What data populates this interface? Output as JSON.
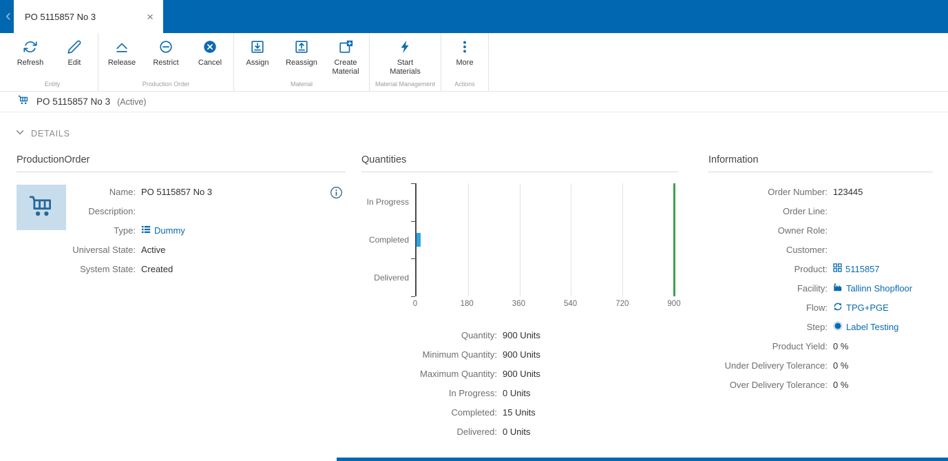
{
  "colors": {
    "topbar": "#0067b0",
    "icon_blue": "#0c6bb0",
    "link": "#0a6ab0",
    "bar_blue": "#2aa5e5",
    "limit_green": "#3ba449",
    "tile_bg": "#c8ddec"
  },
  "topbar": {
    "back_glyph": "‹",
    "tab_title": "PO 5115857 No 3",
    "close_glyph": "×"
  },
  "toolbar": {
    "groups": [
      {
        "label": "Entity",
        "buttons": [
          {
            "label": "Refresh"
          },
          {
            "label": "Edit"
          }
        ]
      },
      {
        "label": "Production Order",
        "buttons": [
          {
            "label": "Release"
          },
          {
            "label": "Restrict"
          },
          {
            "label": "Cancel"
          }
        ]
      },
      {
        "label": "Material",
        "buttons": [
          {
            "label": "Assign"
          },
          {
            "label": "Reassign"
          },
          {
            "label": "Create\nMaterial"
          }
        ]
      },
      {
        "label": "Material Management",
        "buttons": [
          {
            "label": "Start\nMaterials"
          }
        ]
      },
      {
        "label": "Actions",
        "buttons": [
          {
            "label": "More"
          }
        ]
      }
    ]
  },
  "entity_header": {
    "title": "PO 5115857 No 3",
    "state": "(Active)"
  },
  "details_section": {
    "label": "DETAILS"
  },
  "production_order": {
    "title": "ProductionOrder",
    "fields": [
      {
        "label": "Name:",
        "value": "PO 5115857 No 3"
      },
      {
        "label": "Description:",
        "value": ""
      },
      {
        "label": "Type:",
        "value": "Dummy"
      },
      {
        "label": "Universal State:",
        "value": "Active"
      },
      {
        "label": "System State:",
        "value": "Created"
      }
    ]
  },
  "quantities": {
    "title": "Quantities",
    "chart_data": {
      "type": "bar",
      "orientation": "horizontal",
      "categories": [
        "In Progress",
        "Completed",
        "Delivered"
      ],
      "values": [
        0,
        15,
        0
      ],
      "xlim": [
        0,
        900
      ],
      "xticks": [
        0,
        180,
        360,
        540,
        720,
        900
      ],
      "limit_line": 900,
      "grid": true,
      "bar_color": "#2aa5e5",
      "limit_color": "#3ba449"
    },
    "fields": [
      {
        "label": "Quantity:",
        "value": "900 Units"
      },
      {
        "label": "Minimum Quantity:",
        "value": "900 Units"
      },
      {
        "label": "Maximum Quantity:",
        "value": "900 Units"
      },
      {
        "label": "In Progress:",
        "value": "0 Units"
      },
      {
        "label": "Completed:",
        "value": "15 Units"
      },
      {
        "label": "Delivered:",
        "value": "0 Units"
      }
    ]
  },
  "information": {
    "title": "Information",
    "fields": [
      {
        "label": "Order Number:",
        "value": "123445"
      },
      {
        "label": "Order Line:",
        "value": ""
      },
      {
        "label": "Owner Role:",
        "value": ""
      },
      {
        "label": "Customer:",
        "value": ""
      },
      {
        "label": "Product:",
        "value": "5115857"
      },
      {
        "label": "Facility:",
        "value": "Tallinn Shopfloor"
      },
      {
        "label": "Flow:",
        "value": "TPG+PGE"
      },
      {
        "label": "Step:",
        "value": "Label Testing"
      },
      {
        "label": "Product Yield:",
        "value": "0 %"
      },
      {
        "label": "Under Delivery Tolerance:",
        "value": "0 %"
      },
      {
        "label": "Over Delivery Tolerance:",
        "value": "0 %"
      }
    ]
  }
}
